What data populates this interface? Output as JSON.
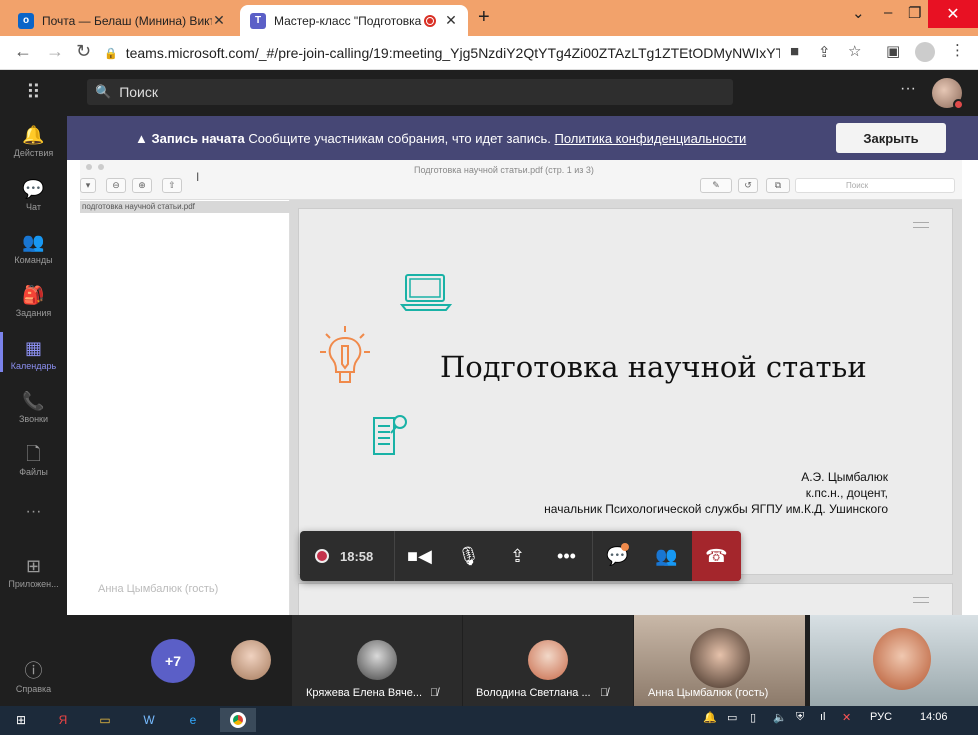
{
  "browser": {
    "tabs": [
      {
        "label": "Почта — Белаш (Минина) Викто",
        "icon": "outlook-icon",
        "color": "#0a64c8"
      },
      {
        "label": "Мастер-класс \"Подготовка",
        "icon": "teams-icon",
        "color": "#5b5fc7",
        "recording": true
      }
    ],
    "new_tab": "+",
    "url": "teams.microsoft.com/_#/pre-join-calling/19:meeting_Yjg5NzdiY2QtYTg4Zi00ZTAzLTg1ZTEtODMyNWIxYTA3..."
  },
  "teams": {
    "search_placeholder": "Поиск",
    "more": "···",
    "rail": [
      {
        "label": "Действия",
        "icon": "bell-icon"
      },
      {
        "label": "Чат",
        "icon": "chat-icon"
      },
      {
        "label": "Команды",
        "icon": "teams-group-icon"
      },
      {
        "label": "Задания",
        "icon": "assignments-icon"
      },
      {
        "label": "Календарь",
        "icon": "calendar-icon",
        "active": true
      },
      {
        "label": "Звонки",
        "icon": "phone-icon"
      },
      {
        "label": "Файлы",
        "icon": "file-icon"
      },
      {
        "label": "···",
        "icon": "more-icon"
      },
      {
        "label": "Приложен...",
        "icon": "apps-icon"
      },
      {
        "label": "Справка",
        "icon": "help-icon"
      }
    ],
    "banner": {
      "bold": "Запись начата",
      "text": "Сообщите участникам собрания, что идет запись.",
      "link": "Политика конфиденциальности",
      "close": "Закрыть"
    }
  },
  "pdf": {
    "title": "Подготовка научной статьи.pdf (стр. 1 из 3)",
    "file": "подготовка научной статьи.pdf",
    "search": "Поиск",
    "slide_title": "Подготовка научной статьи",
    "author_name": "А.Э. Цымбалюк",
    "author_degree": "к.пс.н., доцент,",
    "author_position": "начальник Психологической службы ЯГПУ им.К.Д. Ушинского"
  },
  "meeting": {
    "timer": "18:58",
    "presenter": "Анна Цымбалюк (гость)",
    "more_count": "+7",
    "participants": [
      {
        "name": "Кряжева Елена Вяче...",
        "muted": true
      },
      {
        "name": "Володина Светлана ...",
        "muted": true
      },
      {
        "name": "Анна Цымбалюк (гость)",
        "muted": false
      }
    ]
  },
  "taskbar": {
    "lang": "РУС",
    "time": "14:06"
  }
}
